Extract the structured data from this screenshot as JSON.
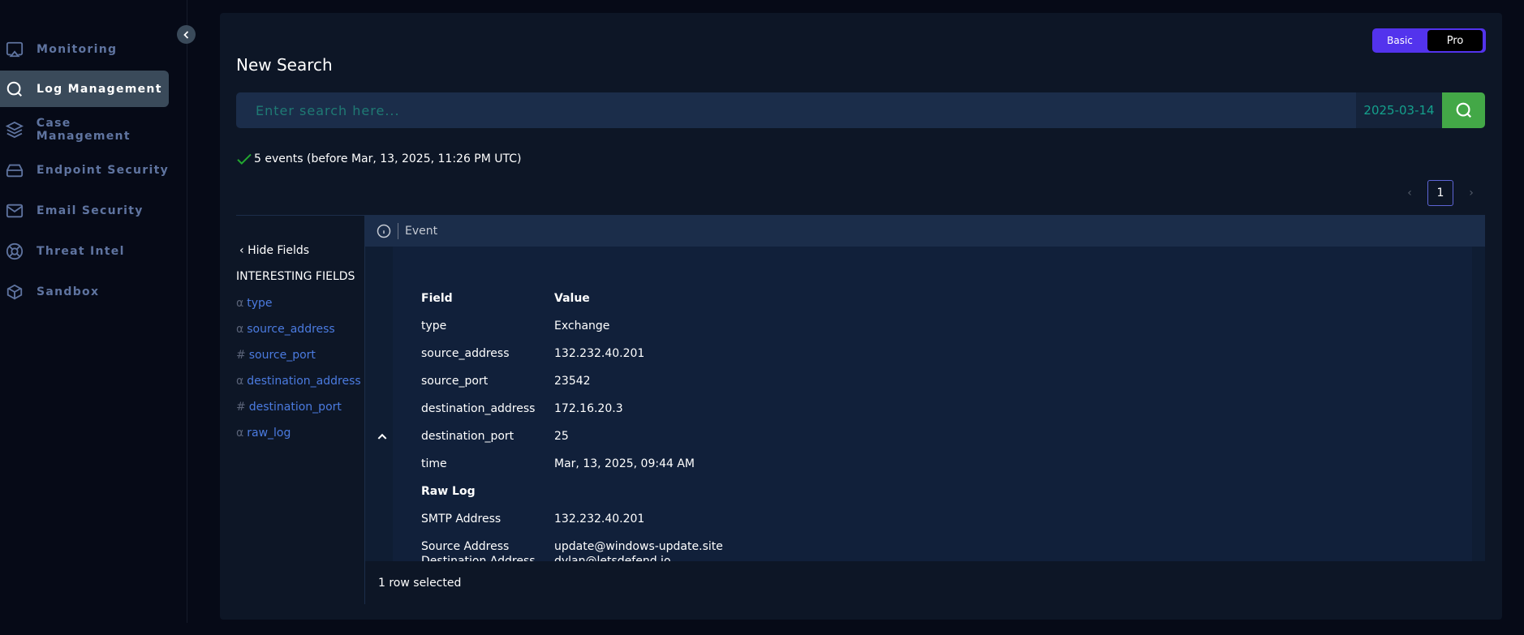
{
  "sidebar": {
    "items": [
      {
        "label": "Monitoring",
        "icon": "monitor-icon"
      },
      {
        "label": "Log Management",
        "icon": "search-icon",
        "active": true
      },
      {
        "label": "Case Management",
        "icon": "layers-icon"
      },
      {
        "label": "Endpoint Security",
        "icon": "hard-drive-icon"
      },
      {
        "label": "Email Security",
        "icon": "mail-icon"
      },
      {
        "label": "Threat Intel",
        "icon": "lifebuoy-icon"
      },
      {
        "label": "Sandbox",
        "icon": "box-icon"
      }
    ]
  },
  "mode_toggle": {
    "basic": "Basic",
    "pro": "Pro",
    "selected": "Pro"
  },
  "page_title": "New Search",
  "search": {
    "placeholder": "Enter search here...",
    "value": "",
    "date": "2025-03-14"
  },
  "status": {
    "text": "5 events (before Mar, 13, 2025, 11:26 PM UTC)"
  },
  "pagination": {
    "current": "1"
  },
  "fields_panel": {
    "hide_label": "Hide Fields",
    "heading": "INTERESTING FIELDS",
    "fields": [
      {
        "type": "α",
        "name": "type"
      },
      {
        "type": "α",
        "name": "source_address"
      },
      {
        "type": "#",
        "name": "source_port"
      },
      {
        "type": "α",
        "name": "destination_address"
      },
      {
        "type": "#",
        "name": "destination_port"
      },
      {
        "type": "α",
        "name": "raw_log"
      }
    ]
  },
  "event_table": {
    "column": "Event",
    "header": {
      "field": "Field",
      "value": "Value"
    },
    "rows": [
      {
        "field": "type",
        "value": "Exchange"
      },
      {
        "field": "source_address",
        "value": "132.232.40.201"
      },
      {
        "field": "source_port",
        "value": "23542"
      },
      {
        "field": "destination_address",
        "value": "172.16.20.3"
      },
      {
        "field": "destination_port",
        "value": "25"
      },
      {
        "field": "time",
        "value": "Mar, 13, 2025, 09:44 AM"
      }
    ],
    "raw_log_heading": "Raw Log",
    "raw_rows": [
      {
        "field": "SMTP Address",
        "value": "132.232.40.201"
      },
      {
        "field": "Source Address",
        "value": "update@windows-update.site"
      },
      {
        "field": "Destination Address",
        "value": "dylan@letsdefend.io"
      }
    ]
  },
  "footer": {
    "selected": "1 row selected"
  },
  "colors": {
    "accent": "#5333ed",
    "search_button": "#43a847",
    "field_link": "#4b7be0",
    "success": "#22a830"
  }
}
